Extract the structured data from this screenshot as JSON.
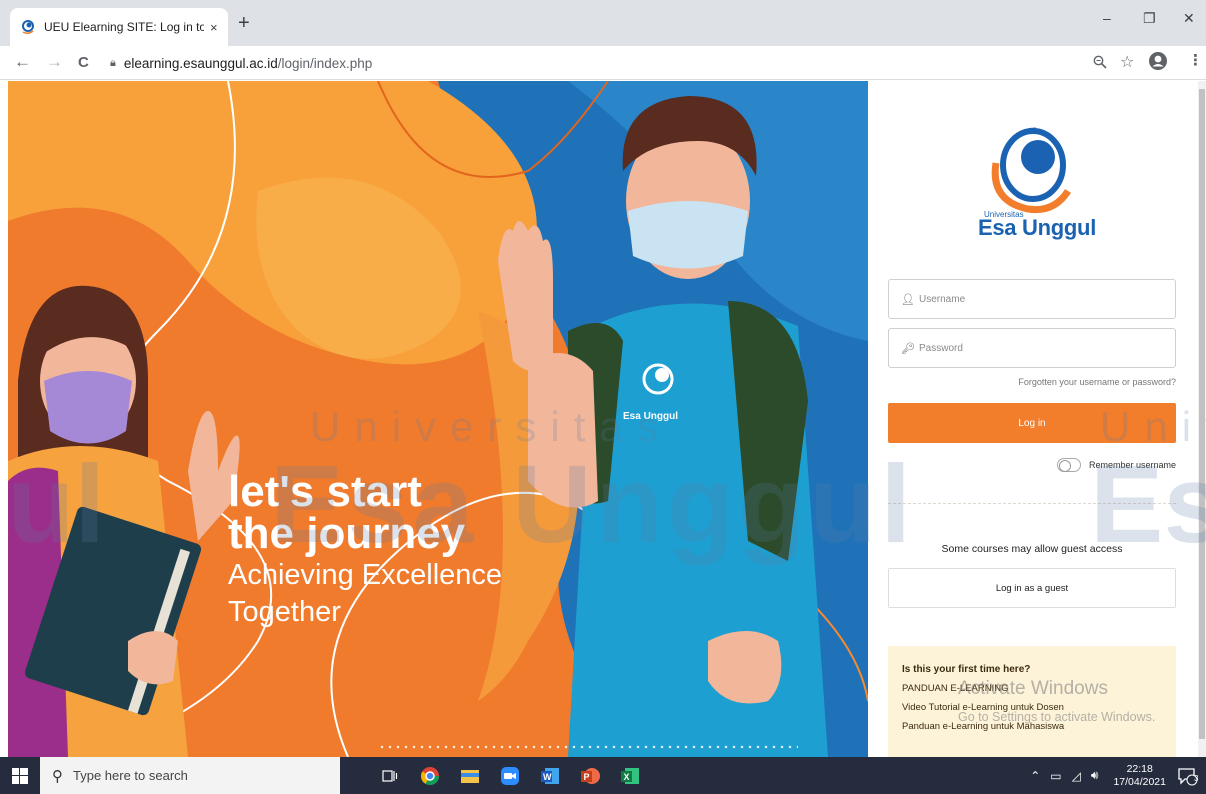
{
  "browser": {
    "tab_title": "UEU Elearning SITE: Log in to the",
    "tab_close": "×",
    "new_tab": "+",
    "url_host": "elearning.esaunggul.ac.id",
    "url_path": "/login/index.php",
    "window_controls": {
      "minimize": "–",
      "restore": "❐",
      "close": "✕"
    },
    "nav": {
      "back": "←",
      "forward": "→",
      "reload": "C"
    },
    "icons": [
      "zoom-icon",
      "star-icon",
      "profile-icon",
      "menu-icon"
    ]
  },
  "hero": {
    "line1": "let's start",
    "line2": "the journey",
    "line3": "Achieving Excellence",
    "line4": "Together",
    "shirt_logo": "Esa Unggul"
  },
  "brand": {
    "small": "Universitas",
    "name": "Esa Unggul",
    "color_blue": "#1b63b2",
    "color_orange": "#f27d2b"
  },
  "login": {
    "username_placeholder": "Username",
    "password_placeholder": "Password",
    "forgot": "Forgotten your username or password?",
    "login_button": "Log in",
    "remember": "Remember username",
    "guest_note": "Some courses may allow guest access",
    "guest_button": "Log in as a guest"
  },
  "info": {
    "title": "Is this your first time here?",
    "links": [
      "PANDUAN E-LEARNING",
      "Video Tutorial e-Learning untuk Dosen",
      "Panduan e-Learning untuk Mahasiswa"
    ]
  },
  "watermark": {
    "small": "Universitas",
    "small2": "Univ",
    "big": "Esa Unggul",
    "big2": "Es",
    "big0": "gul"
  },
  "activation": {
    "line1": "Activate Windows",
    "line2": "Go to Settings to activate Windows."
  },
  "taskbar": {
    "search_placeholder": "Type here to search",
    "time": "22:18",
    "date": "17/04/2021",
    "notification_count": "3"
  }
}
